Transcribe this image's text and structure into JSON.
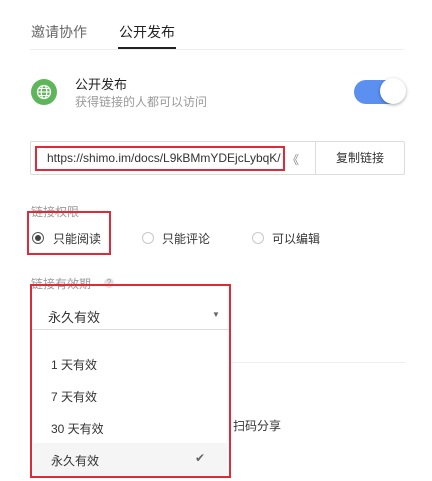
{
  "tabs": [
    {
      "label": "邀请协作",
      "active": false
    },
    {
      "label": "公开发布",
      "active": true
    }
  ],
  "publish": {
    "title": "公开发布",
    "subtitle": "获得链接的人都可以访问",
    "toggle_on": true,
    "toggle_color": "#5b8ff0"
  },
  "link": {
    "url": "https://shimo.im/docs/L9kBMmYDEjcLybqK/",
    "trailing": "《",
    "copy_label": "复制链接"
  },
  "permissions": {
    "label": "链接权限",
    "options": [
      {
        "label": "只能阅读",
        "checked": true
      },
      {
        "label": "只能评论",
        "checked": false
      },
      {
        "label": "可以编辑",
        "checked": false
      }
    ]
  },
  "expiry": {
    "label": "链接有效期",
    "help": "?",
    "selected": "永久有效",
    "options": [
      "1 天有效",
      "7 天有效",
      "30 天有效",
      "永久有效"
    ],
    "check_glyph": "✔"
  },
  "share": {
    "scan_text": "扫码分享"
  },
  "colors": {
    "highlight_red": "#e02a3a",
    "globe_green": "#5fb55a"
  }
}
